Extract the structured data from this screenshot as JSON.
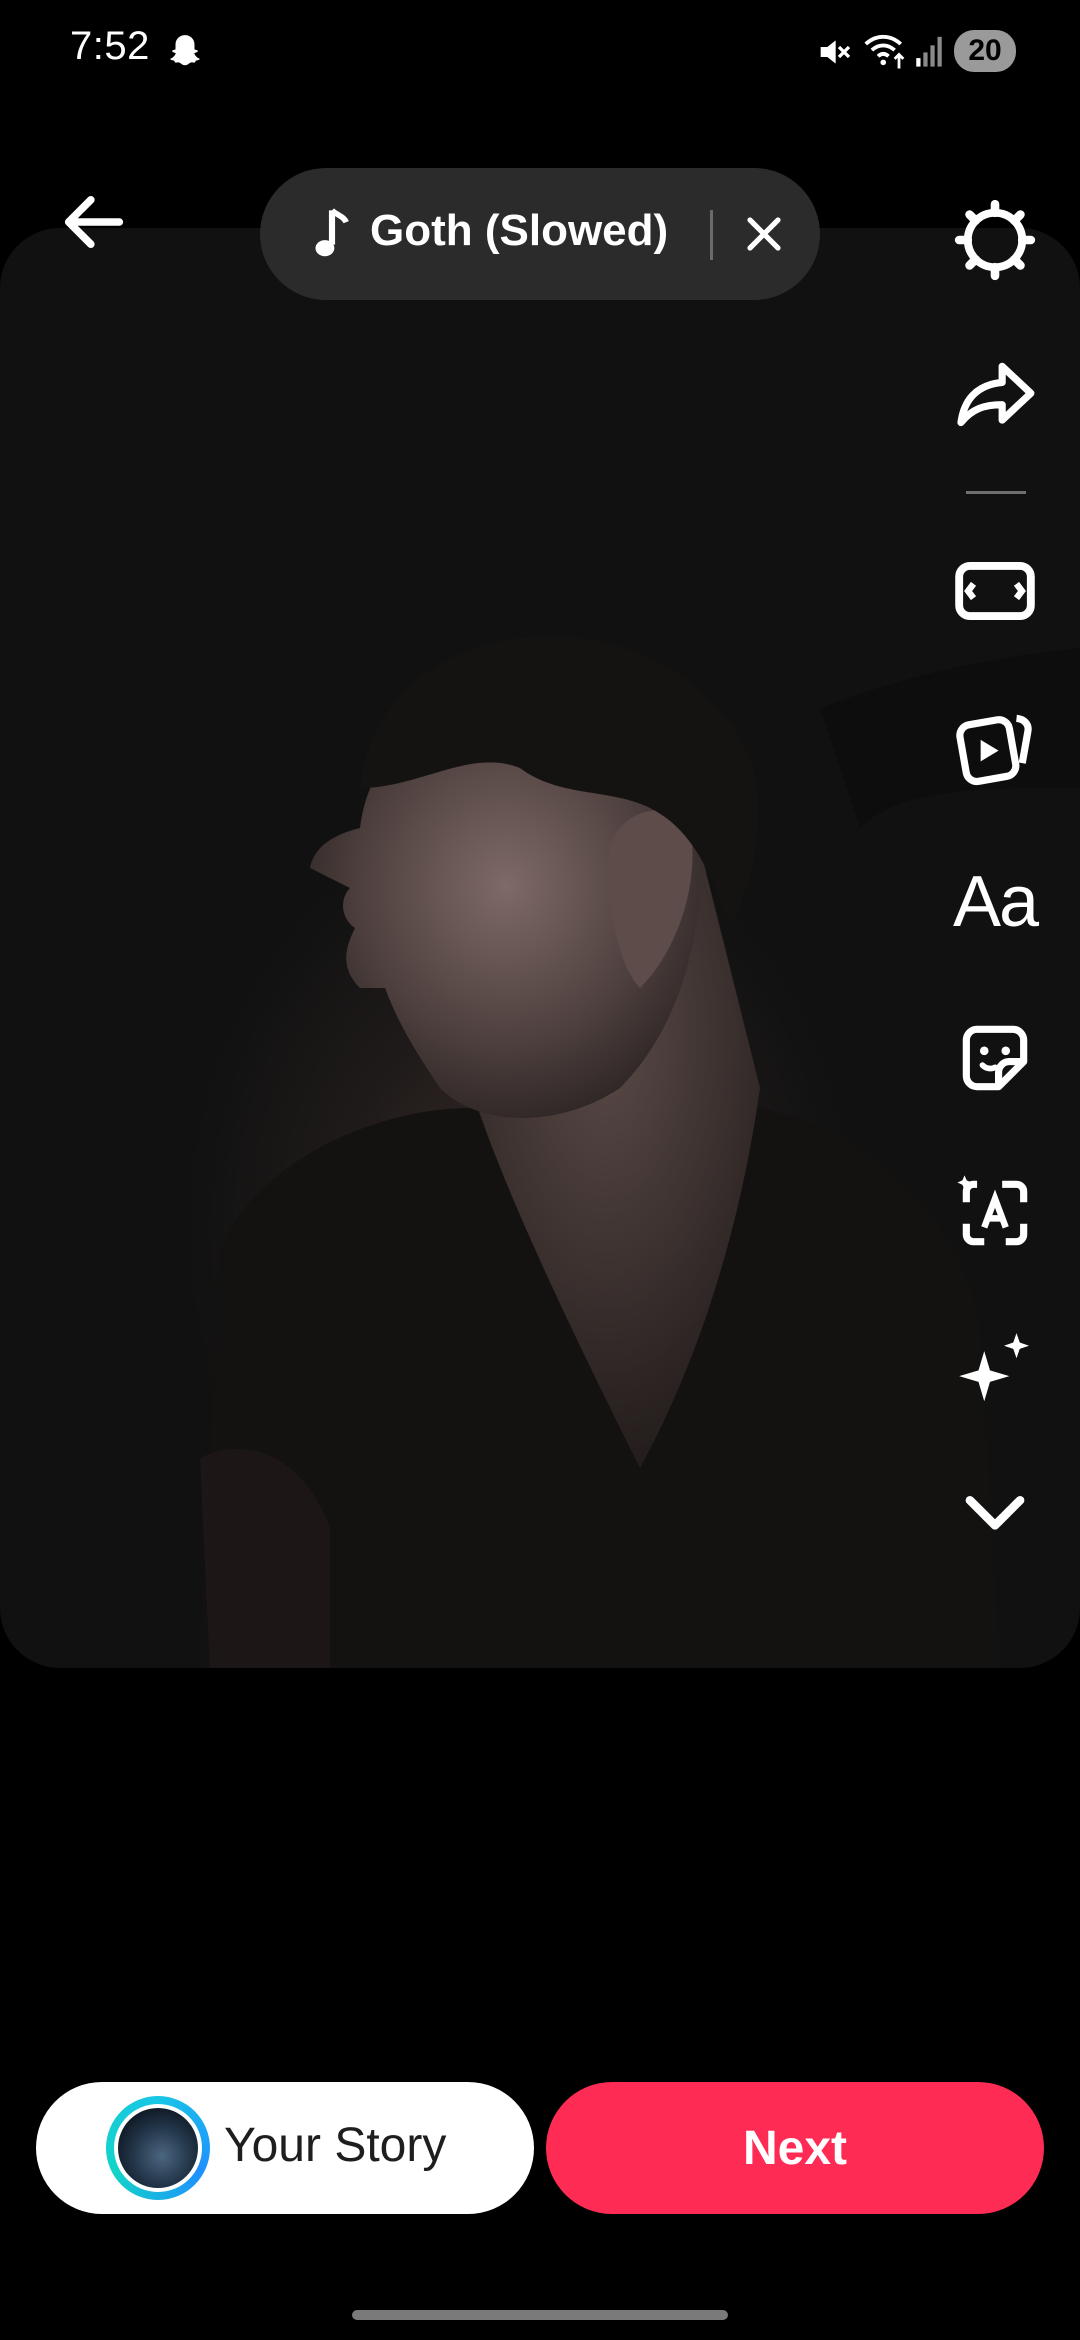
{
  "status_bar": {
    "time": "7:52",
    "battery": "20"
  },
  "music": {
    "title": "Goth (Slowed)"
  },
  "toolbar": {
    "text_tool": "Aa"
  },
  "bottom": {
    "story_label": "Your Story",
    "next_label": "Next"
  },
  "colors": {
    "next_button": "#fe2c55",
    "story_ring": "#19c6e6"
  }
}
